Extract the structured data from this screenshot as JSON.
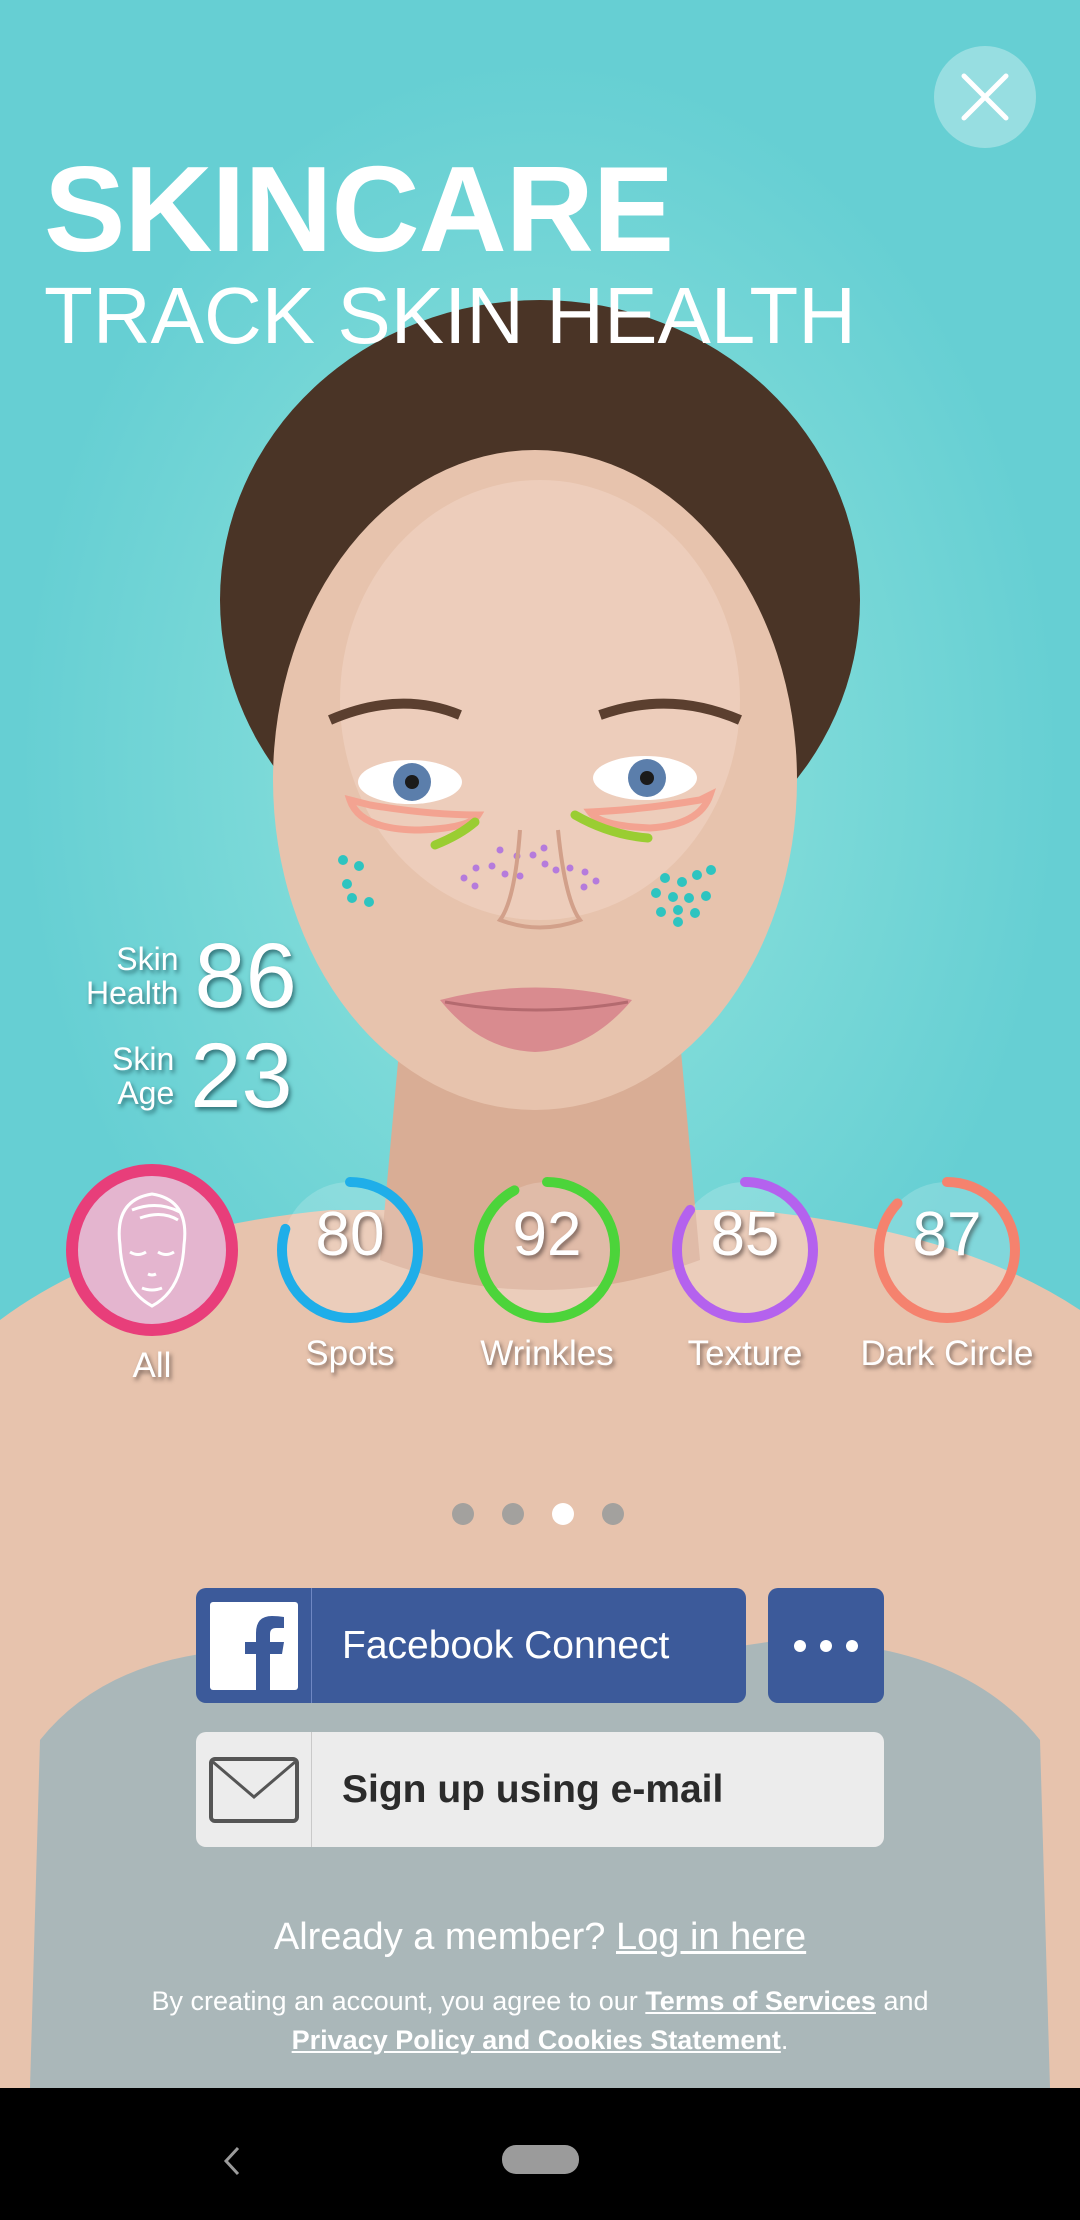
{
  "header": {
    "title": "SKINCARE",
    "subtitle": "TRACK SKIN HEALTH",
    "close_icon": "close-icon"
  },
  "scores": {
    "skin_health": {
      "label_line1": "Skin",
      "label_line2": "Health",
      "value": "86"
    },
    "skin_age": {
      "label_line1": "Skin",
      "label_line2": "Age",
      "value": "23"
    }
  },
  "metrics": [
    {
      "name": "All",
      "icon": "face-icon",
      "color": "#e83e7a",
      "selected": true
    },
    {
      "name": "Spots",
      "value": "80",
      "color": "#1faee9",
      "progress_percent": 80
    },
    {
      "name": "Wrinkles",
      "value": "92",
      "color": "#4cd43a",
      "progress_percent": 92
    },
    {
      "name": "Texture",
      "value": "85",
      "color": "#b462ee",
      "progress_percent": 85
    },
    {
      "name": "Dark Circle",
      "value": "87",
      "color": "#f5826e",
      "progress_percent": 87
    }
  ],
  "pager": {
    "count": 4,
    "active_index": 2
  },
  "buttons": {
    "facebook": {
      "label": "Facebook Connect",
      "icon": "facebook-icon",
      "color": "#3c5a9a"
    },
    "more": {
      "icon": "more-horizontal-icon"
    },
    "email": {
      "label": "Sign up using e-mail",
      "icon": "mail-icon"
    }
  },
  "footer": {
    "member_text": "Already a member? ",
    "login_link": "Log in here",
    "legal_prefix": "By creating an account, you agree to our ",
    "terms_link": "Terms of Services",
    "legal_and": " and",
    "privacy_link": "Privacy Policy and Cookies Statement",
    "legal_suffix": "."
  },
  "navbar": {
    "back_icon": "back-icon",
    "home_icon": "home-pill-icon"
  },
  "colors": {
    "background": "#6ed3d4",
    "facebook_blue": "#3c5a9a",
    "email_bg": "#ececec"
  }
}
